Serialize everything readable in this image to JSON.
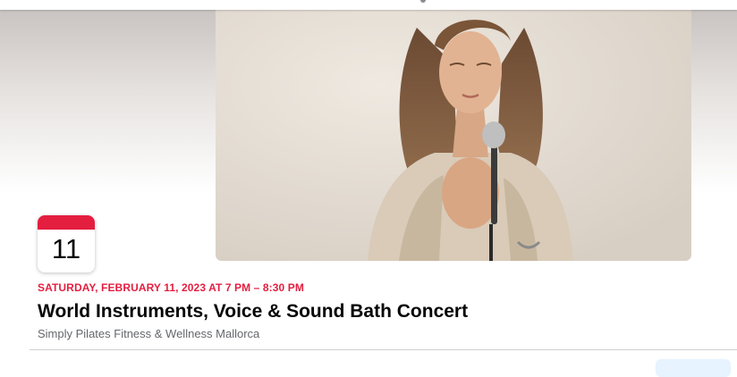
{
  "event": {
    "day": "11",
    "datetime": "SATURDAY, FEBRUARY 11, 2023 AT 7 PM – 8:30 PM",
    "title": "World Instruments, Voice & Sound Bath Concert",
    "host": "Simply Pilates Fitness & Wellness Mallorca"
  },
  "colors": {
    "accent_red": "#e41e3f",
    "link_blue": "#1b74e4",
    "secondary_text": "#65676b"
  },
  "icons": {
    "calendar": "calendar-date-icon"
  }
}
